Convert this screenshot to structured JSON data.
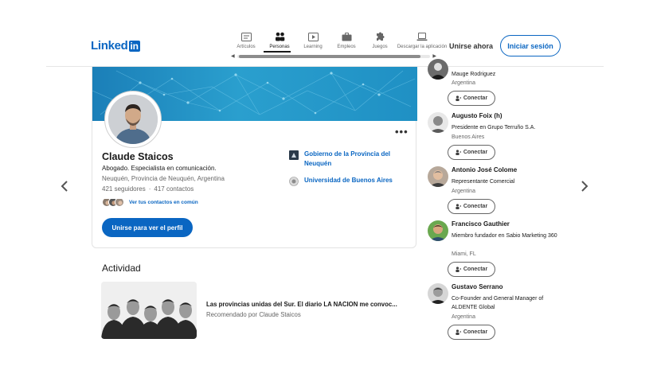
{
  "header": {
    "logo_text": "Linked",
    "logo_box": "in",
    "nav": [
      {
        "label": "Artículos",
        "icon": "articles-icon"
      },
      {
        "label": "Personas",
        "icon": "people-icon",
        "active": true
      },
      {
        "label": "Learning",
        "icon": "learning-icon"
      },
      {
        "label": "Empleos",
        "icon": "jobs-icon"
      },
      {
        "label": "Juegos",
        "icon": "games-icon"
      },
      {
        "label": "Descargar la aplicación",
        "icon": "laptop-icon"
      }
    ],
    "join_label": "Unirse ahora",
    "signin_label": "Iniciar sesión"
  },
  "colors": {
    "brand": "#0a66c2",
    "cover": "#1f90c4"
  },
  "profile": {
    "name": "Claude Staicos",
    "headline": "Abogado. Especialista en comunicación.",
    "location": "Neuquén, Provincia de Neuquén, Argentina",
    "followers": "421 seguidores",
    "separator": "·",
    "contacts": "417 contactos",
    "mutual_link": "Ver tus contactos en común",
    "join_button": "Unirse para ver el perfil",
    "more": "•••",
    "orgs": [
      {
        "name": "Gobierno de la Provincia del Neuquén",
        "icon": "government-logo-icon"
      },
      {
        "name": "Universidad de Buenos Aires",
        "icon": "university-logo-icon"
      }
    ]
  },
  "activity": {
    "title": "Actividad",
    "post": {
      "headline": "Las provincias unidas del Sur. El diario LA NACION me convoc...",
      "sub": "Recomendado por Claude Staicos"
    }
  },
  "people": [
    {
      "name": "",
      "title": "Mauge Rodriguez",
      "location": "Argentina",
      "connect": "Conectar"
    },
    {
      "name": "Augusto Foix (h)",
      "title": "Presidente en Grupo Terruño S.A.",
      "location": "Buenos Aires",
      "connect": "Conectar"
    },
    {
      "name": "Antonio José Colome",
      "title": "Representante Comercial",
      "location": "Argentina",
      "connect": "Conectar"
    },
    {
      "name": "Francisco Gauthier",
      "title": "Miembro fundador en Sabio Marketing 360",
      "location": "Miami, FL",
      "connect": "Conectar"
    },
    {
      "name": "Gustavo Serrano",
      "title": "Co-Founder and General Manager of ALDENTE Global",
      "location": "Argentina",
      "connect": "Conectar"
    }
  ]
}
